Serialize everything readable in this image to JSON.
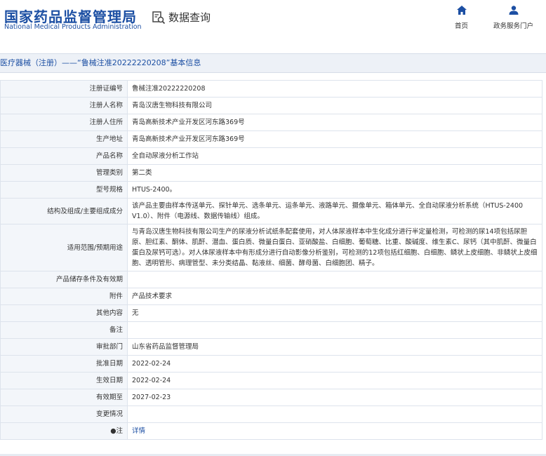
{
  "header": {
    "logo_cn": "国家药品监督管理局",
    "logo_en": "National Medical Products Administration",
    "query_label": "数据查询",
    "nav": [
      {
        "label": "首页",
        "icon": "home-icon"
      },
      {
        "label": "政务服务门户",
        "icon": "user-icon"
      }
    ]
  },
  "title": "医疗器械（注册）——“鲁械注准20222220208”基本信息",
  "rows": [
    {
      "label": "注册证编号",
      "value": "鲁械注准20222220208"
    },
    {
      "label": "注册人名称",
      "value": "青岛汉唐生物科技有限公司"
    },
    {
      "label": "注册人住所",
      "value": "青岛高新技术产业开发区河东路369号"
    },
    {
      "label": "生产地址",
      "value": "青岛高新技术产业开发区河东路369号"
    },
    {
      "label": "产品名称",
      "value": "全自动尿液分析工作站"
    },
    {
      "label": "管理类别",
      "value": "第二类"
    },
    {
      "label": "型号规格",
      "value": "HTUS-2400。"
    },
    {
      "label": "结构及组成/主要组成成分",
      "value": "该产品主要由样本传送单元、探针单元、选条单元、运条单元、液路单元、摄像单元、箱体单元、全自动尿液分析系统（HTUS-2400 V1.0）、附件（电源线、数据传输线）组成。"
    },
    {
      "label": "适用范围/预期用途",
      "value": "与青岛汉唐生物科技有限公司生产的尿液分析试纸条配套使用，对人体尿液样本中生化成分进行半定量检测，可检测的尿14项包括尿胆原、胆红素、酮体、肌酐、潜血、蛋白质、微量白蛋白、亚硝酸盐、白细胞、葡萄糖、比重、酸碱度、维生素C、尿钙（其中肌酐、微量白蛋白及尿钙可选）。对人体尿液样本中有形成分进行自动影像分析鉴别，可检测的12项包括红细胞、白细胞、鳞状上皮细胞、非鳞状上皮细胞、透明管形、病理管型、未分类结晶、黏液丝、细菌、酵母菌、白细胞团、精子。"
    },
    {
      "label": "产品储存条件及有效期",
      "value": ""
    },
    {
      "label": "附件",
      "value": "产品技术要求"
    },
    {
      "label": "其他内容",
      "value": "无"
    },
    {
      "label": "备注",
      "value": ""
    },
    {
      "label": "审批部门",
      "value": "山东省药品监督管理局"
    },
    {
      "label": "批准日期",
      "value": "2022-02-24"
    },
    {
      "label": "生效日期",
      "value": "2022-02-24"
    },
    {
      "label": "有效期至",
      "value": "2027-02-23"
    },
    {
      "label": "变更情况",
      "value": ""
    },
    {
      "label": "●注",
      "value": "详情"
    }
  ],
  "colors": {
    "brand": "#1c4fa3",
    "label_bg": "#f3f6fa",
    "border": "#dde3ec"
  }
}
